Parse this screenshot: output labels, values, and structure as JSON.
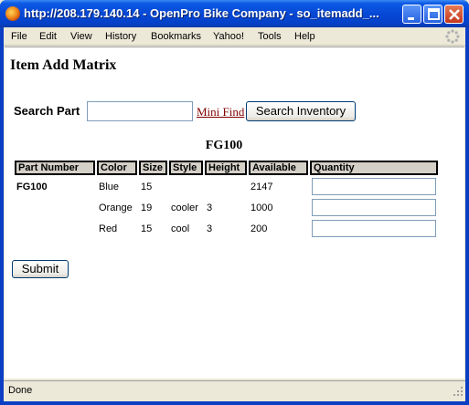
{
  "window": {
    "title": "http://208.179.140.14 - OpenPro Bike Company - so_itemadd_..."
  },
  "menu": {
    "items": [
      "File",
      "Edit",
      "View",
      "History",
      "Bookmarks",
      "Yahoo!",
      "Tools",
      "Help"
    ]
  },
  "page": {
    "title": "Item Add Matrix",
    "search": {
      "label": "Search Part",
      "value": "",
      "mini_find_link": "Mini Find",
      "search_button": "Search Inventory"
    },
    "matrix_heading": "FG100",
    "table": {
      "headers": [
        "Part Number",
        "Color",
        "Size",
        "Style",
        "Height",
        "Available",
        "Quantity"
      ],
      "rows": [
        {
          "part": "FG100",
          "color": "Blue",
          "size": "15",
          "style": "",
          "height": "",
          "available": "2147",
          "quantity": ""
        },
        {
          "part": "",
          "color": "Orange",
          "size": "19",
          "style": "cooler",
          "height": "3",
          "available": "1000",
          "quantity": ""
        },
        {
          "part": "",
          "color": "Red",
          "size": "15",
          "style": "cool",
          "height": "3",
          "available": "200",
          "quantity": ""
        }
      ]
    },
    "submit_button": "Submit"
  },
  "status": {
    "text": "Done"
  },
  "colors": {
    "titlebar": "#0648d6",
    "link": "#800000",
    "header_cell": "#d4d0c8"
  }
}
